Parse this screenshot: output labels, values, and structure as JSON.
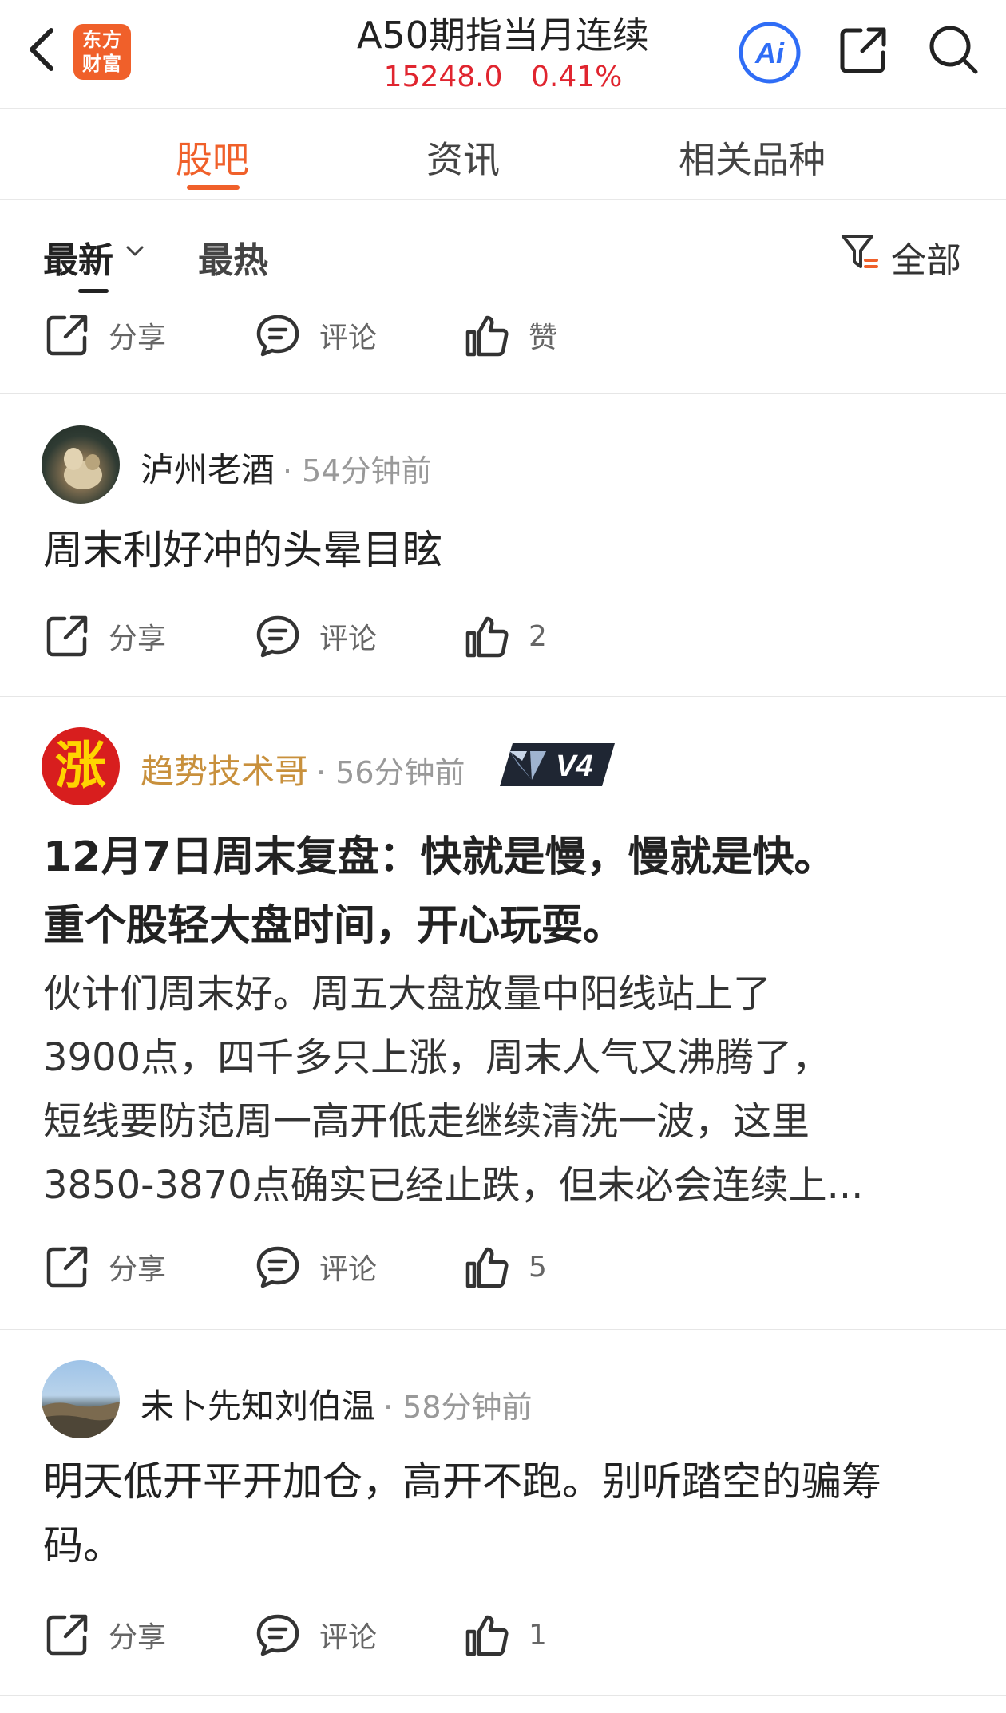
{
  "header": {
    "logo_line1": "东方",
    "logo_line2": "财富",
    "title": "A50期指当月连续",
    "price": "15248.0",
    "change": "0.41%",
    "colors": {
      "accent": "#f0602a",
      "up": "#e0252f",
      "ai_blue": "#2f6df6"
    }
  },
  "tabs": [
    {
      "label": "股吧",
      "active": true
    },
    {
      "label": "资讯",
      "active": false
    },
    {
      "label": "相关品种",
      "active": false
    }
  ],
  "filter": {
    "latest": "最新",
    "hot": "最热",
    "all": "全部"
  },
  "top_actions": {
    "share": "分享",
    "comment": "评论",
    "like": "赞"
  },
  "posts": [
    {
      "user": "泸州老酒",
      "time": "· 54分钟前",
      "content": "周末利好冲的头晕目眩",
      "share": "分享",
      "comment": "评论",
      "likes": "2"
    },
    {
      "user": "趋势技术哥",
      "avatar_char": "涨",
      "time": "· 56分钟前",
      "badge": "V4",
      "title_line1": "12月7日周末复盘：快就是慢，慢就是快。",
      "title_line2": "重个股轻大盘时间，开心玩耍。",
      "body_lines": [
        "伙计们周末好。周五大盘放量中阳线站上了",
        "3900点，四千多只上涨，周末人气又沸腾了，",
        "短线要防范周一高开低走继续清洗一波，这里",
        "3850-3870点确实已经止跌，但未必会连续上..."
      ],
      "share": "分享",
      "comment": "评论",
      "likes": "5"
    },
    {
      "user": "未卜先知刘伯温",
      "time": "· 58分钟前",
      "content_line1": "明天低开平开加仓，高开不跑。别听踏空的骗筹",
      "content_line2": "码。",
      "share": "分享",
      "comment": "评论",
      "likes": "1"
    }
  ]
}
